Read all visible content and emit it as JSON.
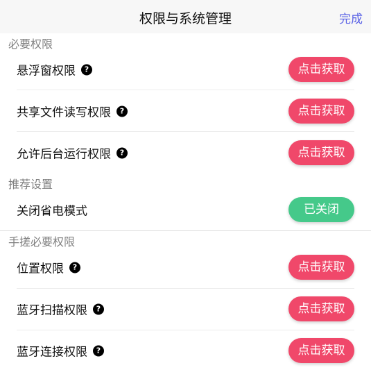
{
  "header": {
    "title": "权限与系统管理",
    "done": "完成"
  },
  "sections": {
    "required": "必要权限",
    "recommended": "推荐设置",
    "manual": "手搓必要权限"
  },
  "rows": {
    "floating": {
      "label": "悬浮窗权限",
      "action": "点击获取"
    },
    "storage": {
      "label": "共享文件读写权限",
      "action": "点击获取"
    },
    "background": {
      "label": "允许后台运行权限",
      "action": "点击获取"
    },
    "power": {
      "label": "关闭省电模式",
      "action": "已关闭"
    },
    "location": {
      "label": "位置权限",
      "action": "点击获取"
    },
    "bt_scan": {
      "label": "蓝牙扫描权限",
      "action": "点击获取"
    },
    "bt_connect": {
      "label": "蓝牙连接权限",
      "action": "点击获取"
    }
  },
  "help_glyph": "?",
  "colors": {
    "accent": "#5b63e6",
    "action_red": "#f0486a",
    "action_green": "#45c98a"
  }
}
